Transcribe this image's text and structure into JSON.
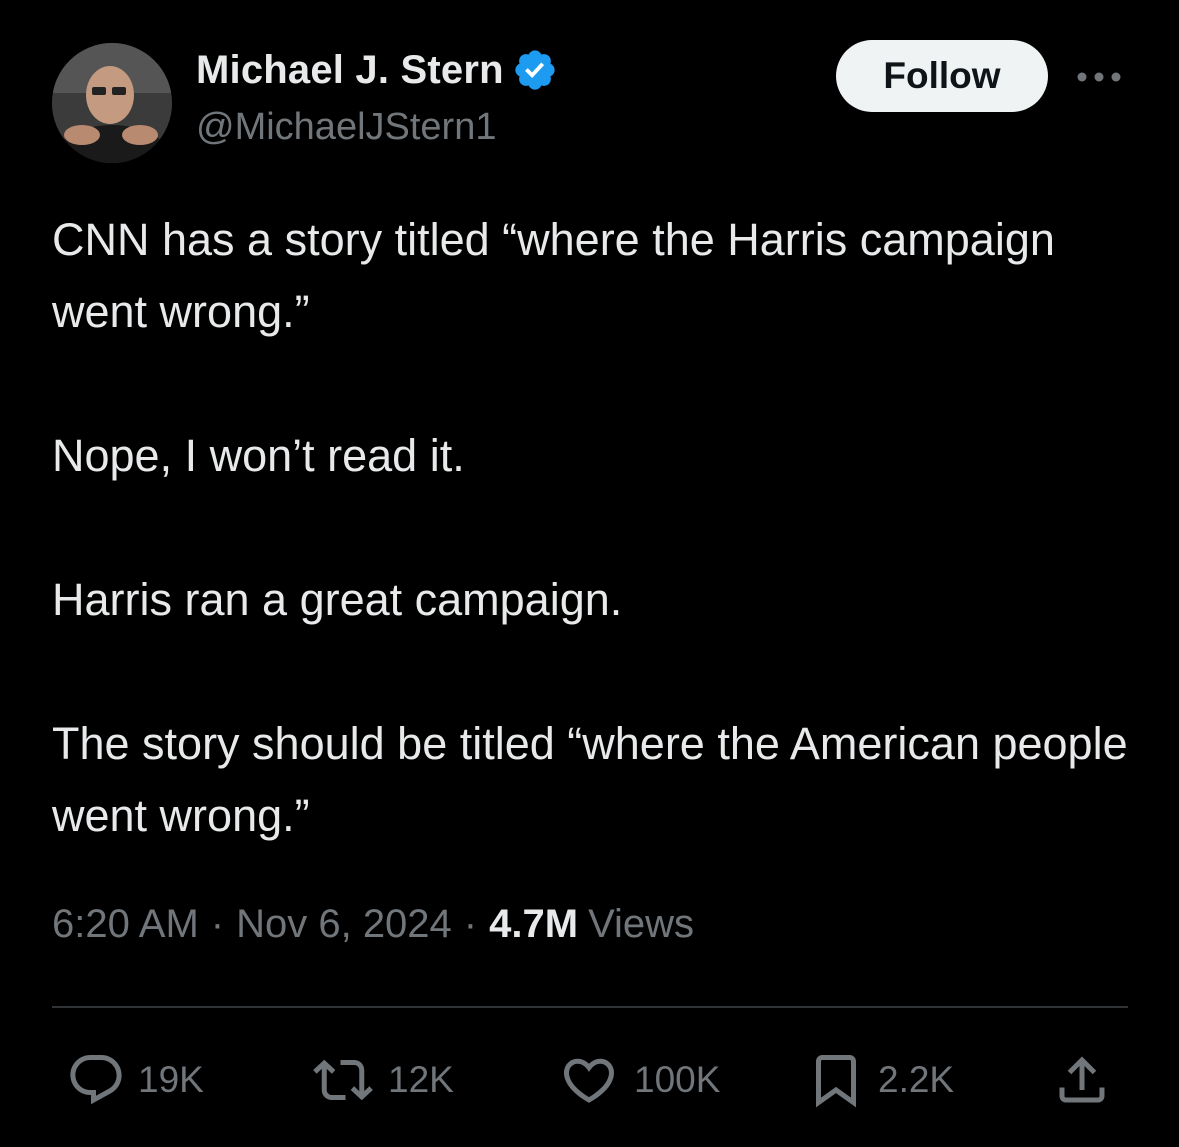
{
  "author": {
    "display_name": "Michael J. Stern",
    "handle": "@MichaelJStern1",
    "verified": true
  },
  "follow_label": "Follow",
  "tweet": {
    "paragraphs": [
      "CNN has a story titled “where the Harris campaign went wrong.”",
      "Nope, I won’t read it.",
      "Harris ran a great campaign.",
      "The story should be titled “where the American people went wrong.”"
    ],
    "time": "6:20 AM",
    "date": "Nov 6, 2024",
    "views_count": "4.7M",
    "views_label": "Views"
  },
  "actions": {
    "replies": "19K",
    "reposts": "12K",
    "likes": "100K",
    "bookmarks": "2.2K"
  },
  "icons": {
    "verified": "verified-badge-icon",
    "more": "more-options-icon",
    "reply": "reply-icon",
    "repost": "repost-icon",
    "like": "heart-icon",
    "bookmark": "bookmark-icon",
    "share": "share-icon"
  },
  "colors": {
    "background": "#000000",
    "text": "#e7e9ea",
    "secondary_text": "#71767b",
    "verified_blue": "#1d9bf0",
    "follow_bg": "#eff3f4",
    "divider": "#2f3336"
  }
}
